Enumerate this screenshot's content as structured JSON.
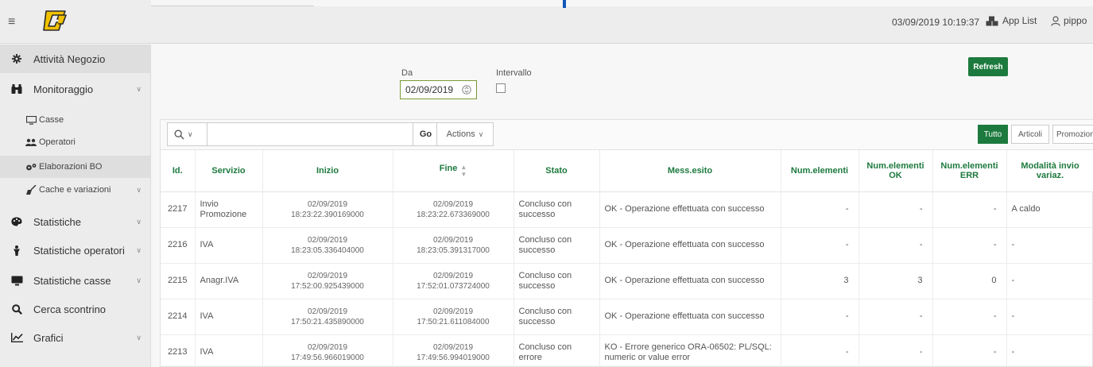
{
  "header": {
    "datetime": "03/09/2019 10:19:37",
    "app_list": "App List",
    "user": "pippo",
    "accent": "#1d7a3e"
  },
  "sidebar": {
    "items": [
      {
        "label": "Attività Negozio",
        "icon": "gear-icon"
      },
      {
        "label": "Monitoraggio",
        "icon": "binoculars-icon"
      },
      {
        "label": "Casse",
        "icon": "monitor-icon"
      },
      {
        "label": "Operatori",
        "icon": "users-icon"
      },
      {
        "label": "Elaborazioni BO",
        "icon": "gears-icon"
      },
      {
        "label": "Cache e variazioni",
        "icon": "broom-icon"
      },
      {
        "label": "Statistiche",
        "icon": "palette-icon"
      },
      {
        "label": "Statistiche operatori",
        "icon": "person-icon"
      },
      {
        "label": "Statistiche casse",
        "icon": "monitor-icon"
      },
      {
        "label": "Cerca scontrino",
        "icon": "search-icon"
      },
      {
        "label": "Grafici",
        "icon": "line-chart-icon"
      }
    ]
  },
  "filters": {
    "da_label": "Da",
    "da_value": "02/09/2019",
    "intervallo_label": "Intervallo",
    "refresh_label": "Refresh"
  },
  "toolbar": {
    "go_label": "Go",
    "actions_label": "Actions",
    "segments": [
      "Tutto",
      "Articoli",
      "Promozioni"
    ]
  },
  "table": {
    "columns": [
      "Id.",
      "Servizio",
      "Inizio",
      "Fine",
      "Stato",
      "Mess.esito",
      "Num.elementi",
      "Num.elementi OK",
      "Num.elementi ERR",
      "Modalità invio variaz."
    ],
    "rows": [
      {
        "id": "2217",
        "servizio": "Invio Promozione",
        "inizio_date": "02/09/2019",
        "inizio_time": "18:23:22.390169000",
        "fine_date": "02/09/2019",
        "fine_time": "18:23:22.673369000",
        "stato": "Concluso con successo",
        "mess": "OK - Operazione effettuata con successo",
        "num": "-",
        "num_ok": "-",
        "num_err": "-",
        "modalita": "A caldo"
      },
      {
        "id": "2216",
        "servizio": "IVA",
        "inizio_date": "02/09/2019",
        "inizio_time": "18:23:05.336404000",
        "fine_date": "02/09/2019",
        "fine_time": "18:23:05.391317000",
        "stato": "Concluso con successo",
        "mess": "OK - Operazione effettuata con successo",
        "num": "-",
        "num_ok": "-",
        "num_err": "-",
        "modalita": "-"
      },
      {
        "id": "2215",
        "servizio": "Anagr.IVA",
        "inizio_date": "02/09/2019",
        "inizio_time": "17:52:00.925439000",
        "fine_date": "02/09/2019",
        "fine_time": "17:52:01.073724000",
        "stato": "Concluso con successo",
        "mess": "OK - Operazione effettuata con successo",
        "num": "3",
        "num_ok": "3",
        "num_err": "0",
        "modalita": "-"
      },
      {
        "id": "2214",
        "servizio": "IVA",
        "inizio_date": "02/09/2019",
        "inizio_time": "17:50:21.435890000",
        "fine_date": "02/09/2019",
        "fine_time": "17:50:21.611084000",
        "stato": "Concluso con successo",
        "mess": "OK - Operazione effettuata con successo",
        "num": "-",
        "num_ok": "-",
        "num_err": "-",
        "modalita": "-"
      },
      {
        "id": "2213",
        "servizio": "IVA",
        "inizio_date": "02/09/2019",
        "inizio_time": "17:49:56.966019000",
        "fine_date": "02/09/2019",
        "fine_time": "17:49:56.994019000",
        "stato": "Concluso con errore",
        "mess": "KO - Errore generico ORA-06502: PL/SQL: numeric or value error",
        "num": "-",
        "num_ok": "-",
        "num_err": "-",
        "modalita": "-"
      }
    ]
  }
}
